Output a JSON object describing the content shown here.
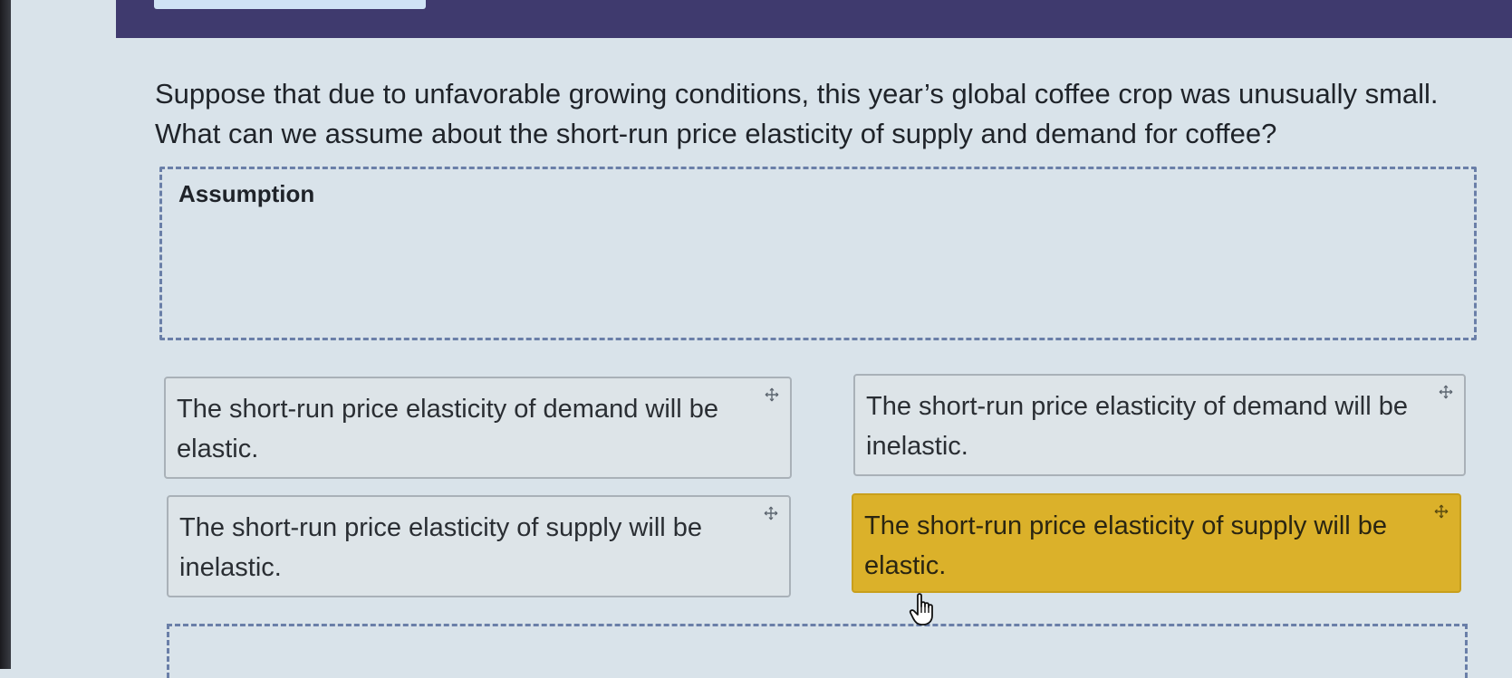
{
  "question": {
    "text": "Suppose that due to unfavorable growing conditions, this year’s global coffee crop was unusually small. What can we assume about the short-run price elasticity of supply and demand for coffee?"
  },
  "drop_zone": {
    "label": "Assumption"
  },
  "options": [
    {
      "text": "The short-run price elasticity of demand will be elastic.",
      "selected": false
    },
    {
      "text": "The short-run price elasticity of demand will be inelastic.",
      "selected": false
    },
    {
      "text": "The short-run price elasticity of supply will be inelastic.",
      "selected": false
    },
    {
      "text": "The short-run price elasticity of supply will be elastic.",
      "selected": true
    }
  ],
  "icons": {
    "card_handle": "move-icon",
    "cursor": "hand-pointer-icon"
  },
  "colors": {
    "header_bar": "#3f3a6e",
    "selected_card": "#dbb12a",
    "drop_zone_border": "#6a7fa8"
  }
}
